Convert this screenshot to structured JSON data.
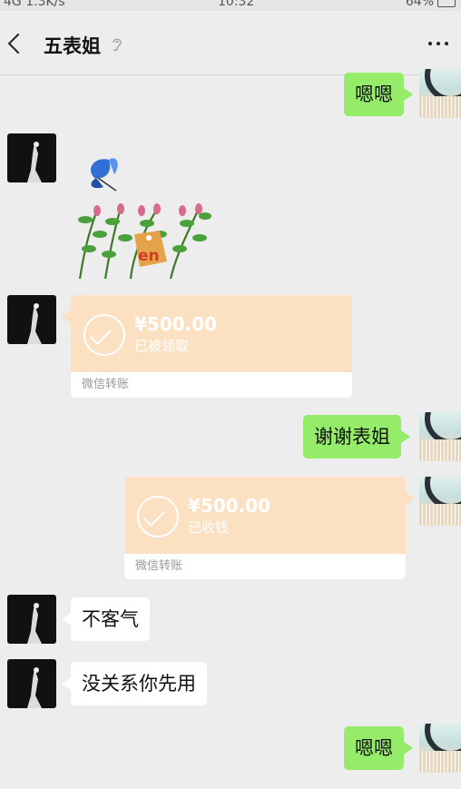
{
  "status_bar": {
    "network": "4G",
    "speed": "1.3K/s",
    "time": "10:32",
    "battery": "64%"
  },
  "header": {
    "title": "五表姐"
  },
  "messages": {
    "m1": "嗯嗯",
    "t1": {
      "amount": "¥500.00",
      "status": "已被领取",
      "footer": "微信转账"
    },
    "m2": "谢谢表姐",
    "t2": {
      "amount": "¥500.00",
      "status": "已收钱",
      "footer": "微信转账"
    },
    "m3": "不客气",
    "m4": "没关系你先用",
    "m5": "嗯嗯"
  },
  "sticker": {
    "tag_text": "en"
  },
  "colors": {
    "sent_bubble": "#95ec69",
    "received_bubble": "#ffffff",
    "transfer_card": "#fbe0c2",
    "background": "#ededed"
  }
}
